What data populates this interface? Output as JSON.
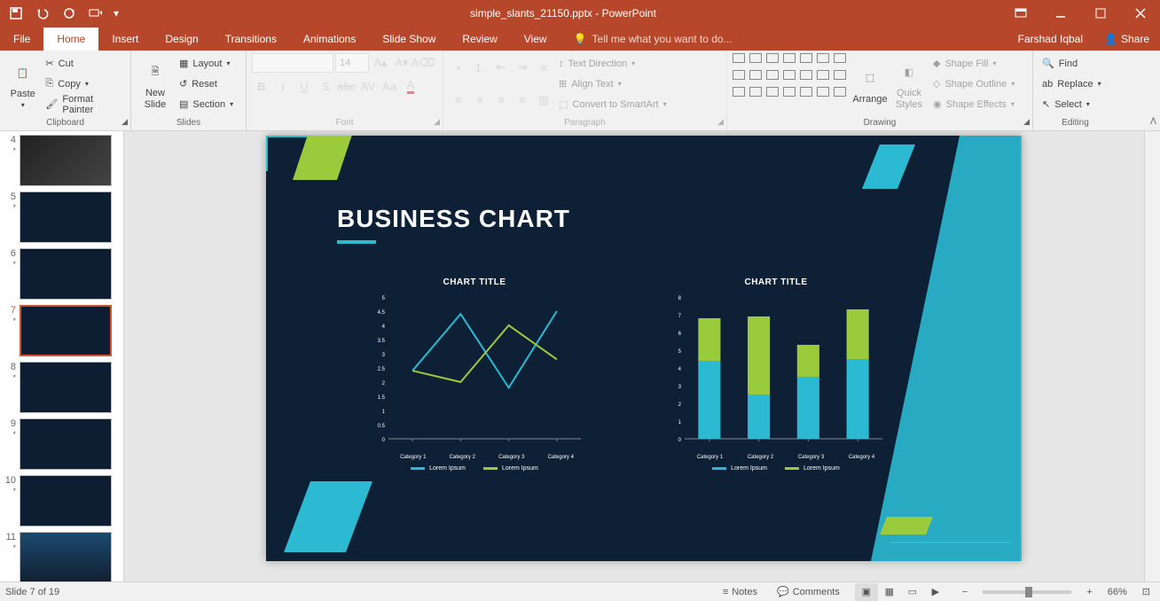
{
  "window": {
    "title": "simple_slants_21150.pptx - PowerPoint"
  },
  "user": {
    "name": "Farshad Iqbal",
    "share": "Share"
  },
  "tabs": {
    "file": "File",
    "home": "Home",
    "insert": "Insert",
    "design": "Design",
    "transitions": "Transitions",
    "animations": "Animations",
    "slideshow": "Slide Show",
    "review": "Review",
    "view": "View",
    "tellme": "Tell me what you want to do..."
  },
  "ribbon": {
    "clipboard": {
      "label": "Clipboard",
      "paste": "Paste",
      "cut": "Cut",
      "copy": "Copy",
      "format_painter": "Format Painter"
    },
    "slides": {
      "label": "Slides",
      "new_slide": "New\nSlide",
      "layout": "Layout",
      "reset": "Reset",
      "section": "Section"
    },
    "font": {
      "label": "Font",
      "name": "",
      "size": "14"
    },
    "paragraph": {
      "label": "Paragraph",
      "text_direction": "Text Direction",
      "align_text": "Align Text",
      "smartart": "Convert to SmartArt"
    },
    "drawing": {
      "label": "Drawing",
      "arrange": "Arrange",
      "quick_styles": "Quick\nStyles",
      "shape_fill": "Shape Fill",
      "shape_outline": "Shape Outline",
      "shape_effects": "Shape Effects"
    },
    "editing": {
      "label": "Editing",
      "find": "Find",
      "replace": "Replace",
      "select": "Select"
    }
  },
  "thumbs": [
    {
      "n": 4
    },
    {
      "n": 5
    },
    {
      "n": 6
    },
    {
      "n": 7,
      "active": true
    },
    {
      "n": 8
    },
    {
      "n": 9
    },
    {
      "n": 10
    },
    {
      "n": 11
    }
  ],
  "slide": {
    "heading": "BUSINESS CHART",
    "chart1_title": "CHART TITLE",
    "chart2_title": "CHART TITLE",
    "legend_a": "Lorem Ipsum",
    "legend_b": "Lorem Ipsum",
    "categories": [
      "Category 1",
      "Category 2",
      "Category 3",
      "Category 4"
    ]
  },
  "status": {
    "page": "Slide 7 of 19",
    "notes": "Notes",
    "comments": "Comments",
    "zoom": "66%"
  },
  "chart_data": [
    {
      "type": "line",
      "title": "CHART TITLE",
      "categories": [
        "Category 1",
        "Category 2",
        "Category 3",
        "Category 4"
      ],
      "series": [
        {
          "name": "Lorem Ipsum",
          "color": "#2bbad1",
          "values": [
            2.4,
            4.4,
            1.8,
            4.5
          ]
        },
        {
          "name": "Lorem Ipsum",
          "color": "#9acb3c",
          "values": [
            2.4,
            2.0,
            4.0,
            2.8
          ]
        }
      ],
      "ylim": [
        0,
        5
      ],
      "ytick": 0.5,
      "xlabel": "",
      "ylabel": ""
    },
    {
      "type": "bar",
      "stacked": true,
      "title": "CHART TITLE",
      "categories": [
        "Category 1",
        "Category 2",
        "Category 3",
        "Category 4"
      ],
      "series": [
        {
          "name": "Lorem Ipsum",
          "color": "#2bbad1",
          "values": [
            4.4,
            2.5,
            3.5,
            4.5
          ]
        },
        {
          "name": "Lorem Ipsum",
          "color": "#9acb3c",
          "values": [
            2.4,
            4.4,
            1.8,
            2.8
          ]
        }
      ],
      "ylim": [
        0,
        8
      ],
      "ytick": 1,
      "xlabel": "",
      "ylabel": ""
    }
  ]
}
